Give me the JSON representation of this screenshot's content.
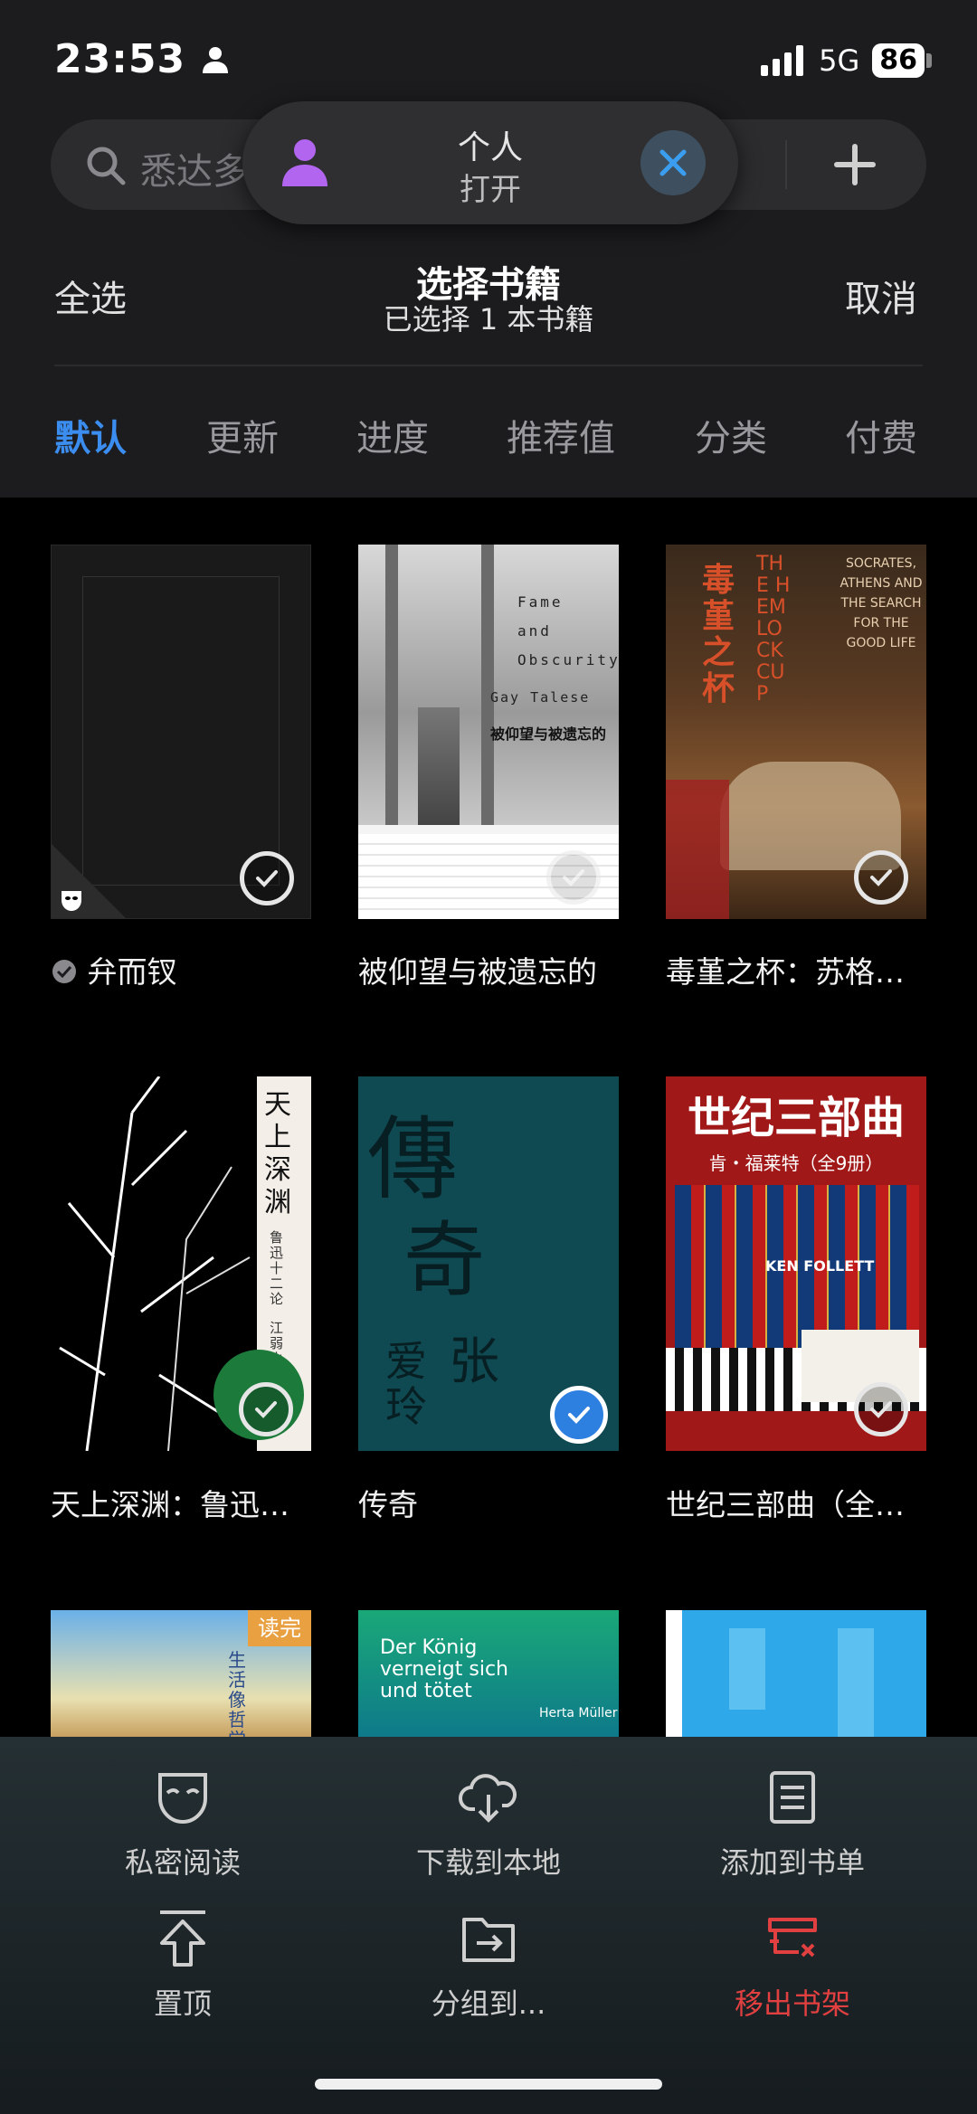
{
  "status_bar": {
    "time": "23:53",
    "network": "5G",
    "battery": "86"
  },
  "search": {
    "placeholder": "悉达多"
  },
  "toast": {
    "title": "个人",
    "subtitle": "打开"
  },
  "header": {
    "select_all": "全选",
    "title": "选择书籍",
    "subtitle": "已选择 1 本书籍",
    "cancel": "取消"
  },
  "tabs": [
    "默认",
    "更新",
    "进度",
    "推荐值",
    "分类",
    "付费"
  ],
  "books": [
    {
      "title": "弁而钗",
      "selected": false
    },
    {
      "title": "被仰望与被遗忘的",
      "selected": false
    },
    {
      "title": "毒堇之杯：苏格…",
      "selected": false
    },
    {
      "title": "天上深渊：鲁迅…",
      "selected": false
    },
    {
      "title": "传奇",
      "selected": true
    },
    {
      "title": "世纪三部曲（全…",
      "selected": false
    }
  ],
  "covers": {
    "fame": {
      "line1": "Fame",
      "line2": "and",
      "line3": "Obscurity",
      "author": "Gay Talese",
      "cn": "被仰望与被遗忘的"
    },
    "hemlock": {
      "cn": "毒堇之杯",
      "en": "THE HEMLOCK CUP",
      "side": "SOCRATES, ATHENS AND THE SEARCH FOR THE GOOD LIFE"
    },
    "abyss": {
      "cn": "天上深渊",
      "sub": "鲁迅十二论",
      "author": "江弱水"
    },
    "chuanqi": {
      "title_a": "傳",
      "title_b": "奇",
      "author_a": "张",
      "author_b": "爱玲"
    },
    "century": {
      "title": "世纪三部曲",
      "author": "肯・福莱特（全9册）",
      "brand": "KEN FOLLETT"
    },
    "row3a": {
      "badge": "读完",
      "cn": "生活 像哲学家一样"
    },
    "row3b": {
      "en1": "Der König",
      "en2": "verneigt sich",
      "en3": "und tötet",
      "author": "Herta Müller"
    }
  },
  "actions": [
    {
      "label": "私密阅读",
      "icon": "mask-icon"
    },
    {
      "label": "下载到本地",
      "icon": "cloud-download-icon"
    },
    {
      "label": "添加到书单",
      "icon": "booklist-icon"
    },
    {
      "label": "置顶",
      "icon": "pin-top-icon"
    },
    {
      "label": "分组到...",
      "icon": "folder-move-icon"
    },
    {
      "label": "移出书架",
      "icon": "remove-shelf-icon"
    }
  ],
  "colors": {
    "accent": "#3b8df0",
    "danger": "#e24040"
  }
}
